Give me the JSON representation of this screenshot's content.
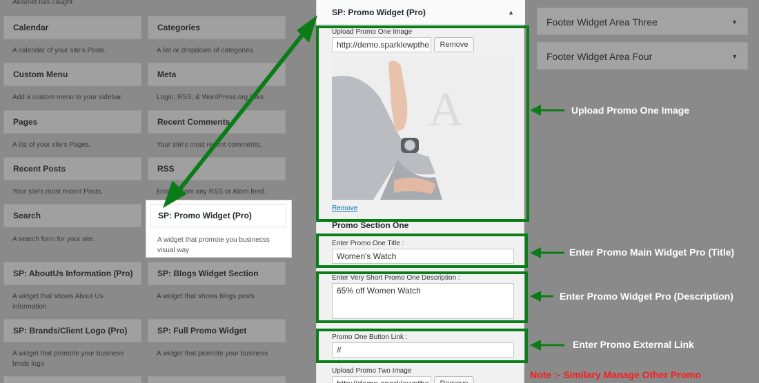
{
  "top_text": "Akismet has caught",
  "widgets": [
    {
      "title": "Calendar",
      "desc": "A calendar of your site's Posts."
    },
    {
      "title": "Categories",
      "desc": "A list or dropdown of categories."
    },
    {
      "title": "Custom Menu",
      "desc": "Add a custom menu to your sidebar."
    },
    {
      "title": "Meta",
      "desc": "Login, RSS, & WordPress.org links."
    },
    {
      "title": "Pages",
      "desc": "A list of your site's Pages."
    },
    {
      "title": "Recent Comments",
      "desc": "Your site's most recent comments."
    },
    {
      "title": "Recent Posts",
      "desc": "Your site's most recent Posts."
    },
    {
      "title": "RSS",
      "desc": "Entries from any RSS or Atom feed."
    },
    {
      "title": "Search",
      "desc": "A search form for your site."
    },
    {
      "title": "SP: Promo Widget (Pro)",
      "desc": "A widget that promote you businecss visual way"
    },
    {
      "title": "SP: AboutUs Information (Pro)",
      "desc": "A widget that shows About Us information"
    },
    {
      "title": "SP: Blogs Widget Section",
      "desc": "A widget that shows blogs posts"
    },
    {
      "title": "SP: Brands/Client Logo (Pro)",
      "desc": "A widget that promote your business bmds logo"
    },
    {
      "title": "SP: Full Promo Widget",
      "desc": "A widget that promote your business"
    }
  ],
  "footer_areas": [
    "Footer Widget Area Three",
    "Footer Widget Area Four"
  ],
  "panel": {
    "title": "SP: Promo Widget (Pro)",
    "upload_one_label": "Upload Promo One Image",
    "upload_one_url": "http://demo.sparklewpthe",
    "remove_button": "Remove",
    "remove_link": "Remove",
    "section_title": "Promo Section One",
    "title_label": "Enter Promo One Title :",
    "title_value": "Women's Watch",
    "desc_label": "Enter Very Short Promo One Description :",
    "desc_value": "65% off Women Watch",
    "link_label": "Promo One Button Link :",
    "link_value": "#",
    "upload_two_label": "Upload Promo Two Image",
    "upload_two_url": "http://demo.sparklewpthe",
    "remove_button_two": "Remove"
  },
  "annotations": {
    "image": "Upload Promo One Image",
    "title": "Enter Promo Main Widget Pro (Title)",
    "desc": "Enter Promo Widget Pro (Description)",
    "link": "Enter Promo External Link",
    "note": "Note :- Similary Manage Other Promo"
  },
  "colors": {
    "annotation_green": "#0a7d16",
    "note_red": "#ff1a1a",
    "link_blue": "#0073aa"
  }
}
